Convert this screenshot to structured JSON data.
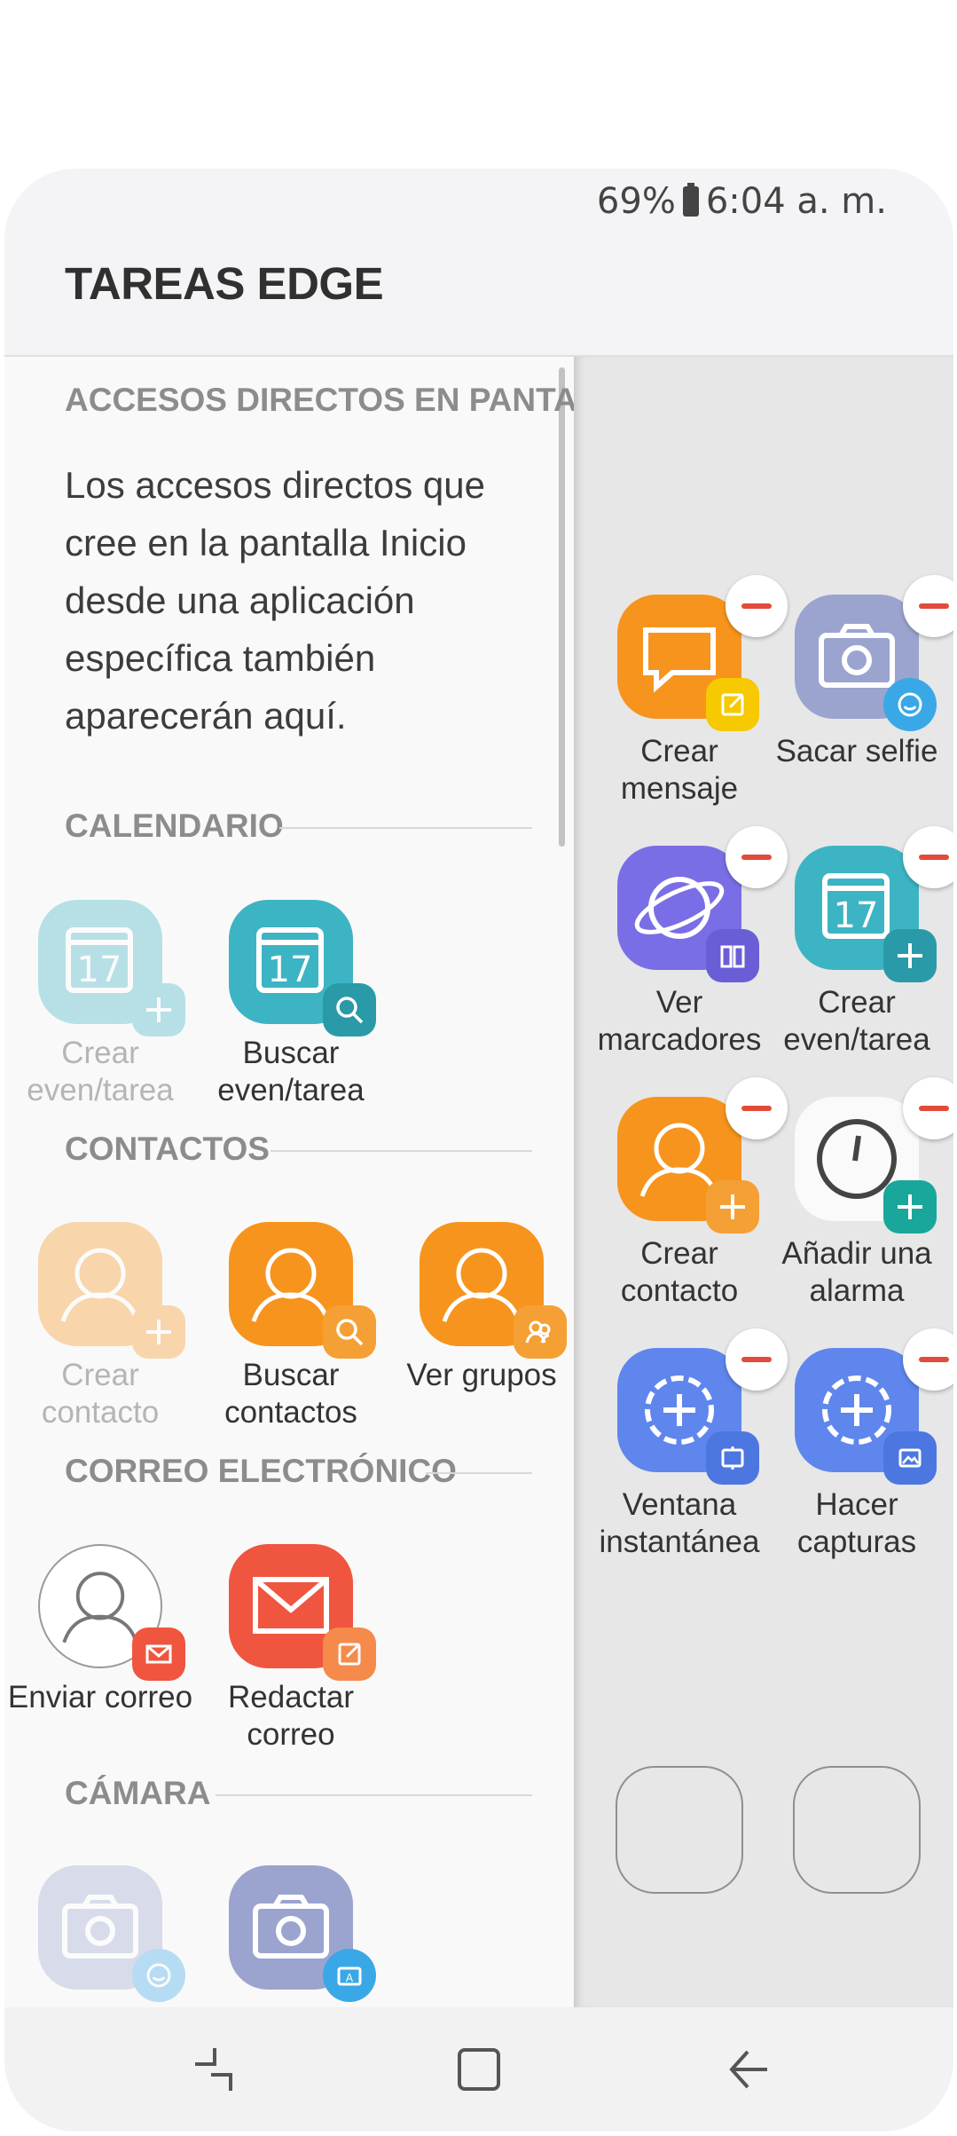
{
  "status": {
    "battery": "69%",
    "time": "6:04 a. m."
  },
  "header": {
    "title": "TAREAS EDGE"
  },
  "sections": {
    "shortcuts": "ACCESOS DIRECTOS EN PANTAL...",
    "calendar": "CALENDARIO",
    "contacts": "CONTACTOS",
    "email": "CORREO ELECTRÓNICO",
    "camera": "CÁMARA"
  },
  "shortcuts_desc": "Los accesos directos que cree en la pantalla Inicio desde una aplicación específica también aparecerán aquí.",
  "calendar_apps": [
    {
      "label": "Crear even/tarea",
      "enabled": false
    },
    {
      "label": "Buscar even/tarea",
      "enabled": true
    }
  ],
  "contact_apps": [
    {
      "label": "Crear contacto",
      "enabled": false
    },
    {
      "label": "Buscar contactos",
      "enabled": true
    },
    {
      "label": "Ver grupos",
      "enabled": true
    }
  ],
  "email_apps": [
    {
      "label": "Enviar correo",
      "enabled": true
    },
    {
      "label": "Redactar correo",
      "enabled": true
    }
  ],
  "camera_apps": [
    {
      "label": "",
      "enabled": false
    },
    {
      "label": "",
      "enabled": true
    }
  ],
  "edge_tasks": [
    {
      "label": "Crear mensaje",
      "icon": "message-icon"
    },
    {
      "label": "Sacar selfie",
      "icon": "camera-icon"
    },
    {
      "label": "Ver marcadores",
      "icon": "internet-icon"
    },
    {
      "label": "Crear even/tarea",
      "icon": "calendar-icon"
    },
    {
      "label": "Crear contacto",
      "icon": "contact-icon"
    },
    {
      "label": "Añadir una alarma",
      "icon": "clock-icon"
    },
    {
      "label": "Ventana instantánea",
      "icon": "settings-icon"
    },
    {
      "label": "Hacer capturas",
      "icon": "settings-icon"
    }
  ],
  "colors": {
    "orange": "#f7941d",
    "teal": "#3db4c3",
    "lavender": "#9aa4cf",
    "purple": "#7a6ee6",
    "blue": "#5f86ec",
    "red": "#f0553f",
    "remove_red": "#e24b3a"
  }
}
